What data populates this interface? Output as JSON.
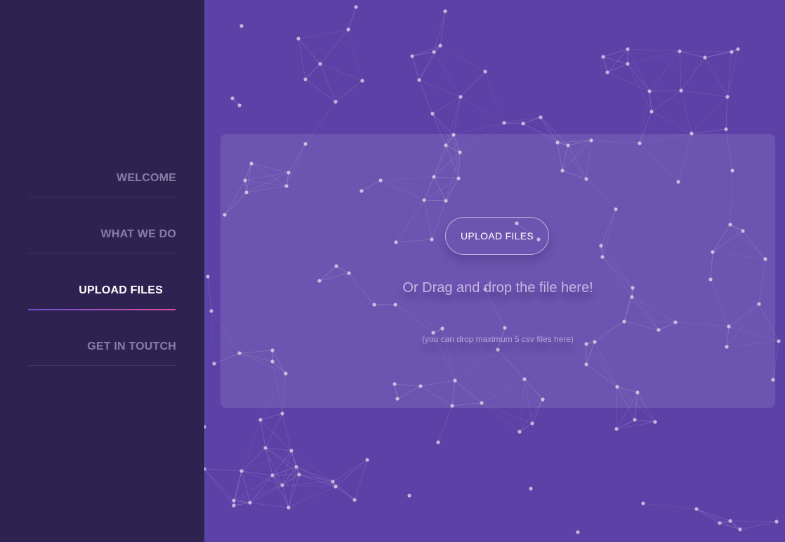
{
  "sidebar": {
    "items": [
      {
        "label": "WELCOME"
      },
      {
        "label": "WHAT WE DO"
      },
      {
        "label": "UPLOAD FILES",
        "active": true
      },
      {
        "label": "GET IN TOUTCH"
      }
    ]
  },
  "upload": {
    "button_label": "UPLOAD FILES",
    "drop_text": "Or Drag and drop the file here!",
    "note": "(you can drop maximum 5 csv files here)"
  },
  "colors": {
    "sidebar_bg": "#2e2350",
    "main_bg": "#5c42a7",
    "accent_gradient_start": "#6b4fd8",
    "accent_gradient_end": "#d8509a",
    "particle": "#c8b6dc"
  }
}
